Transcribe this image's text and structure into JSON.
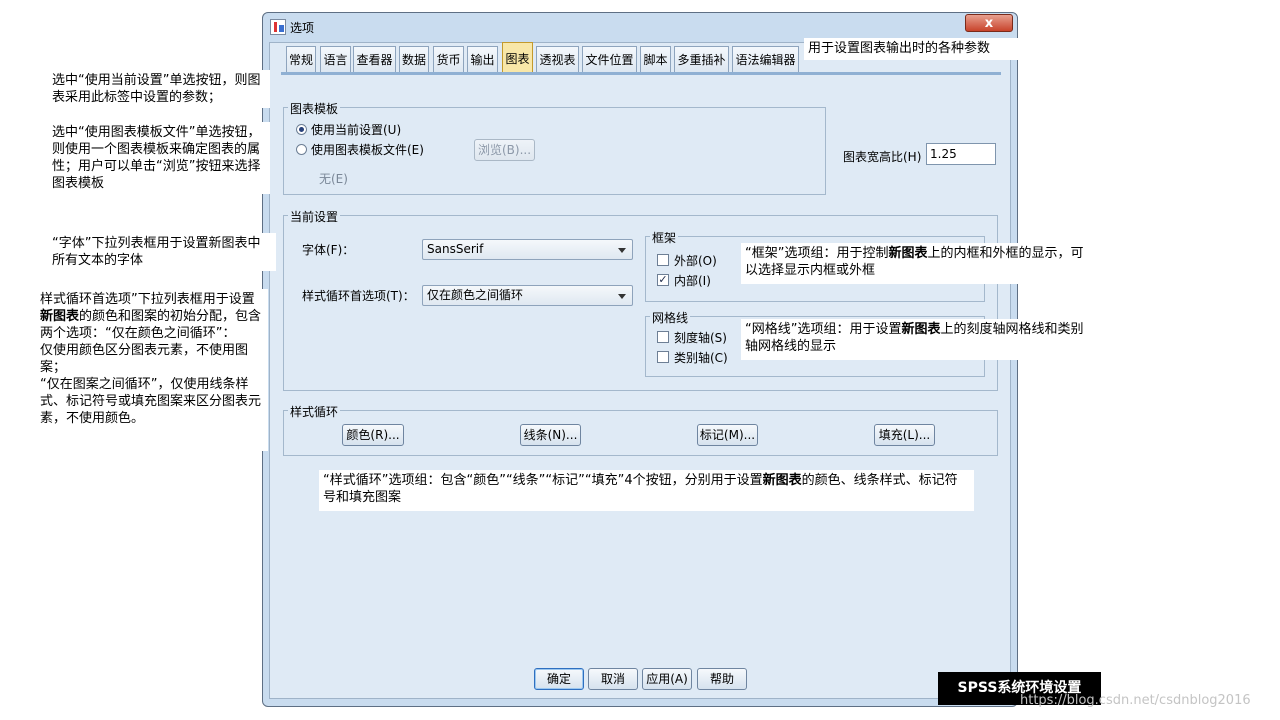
{
  "window": {
    "title": "选项",
    "close_glyph": "x"
  },
  "tabs": [
    {
      "label": "常规"
    },
    {
      "label": "语言"
    },
    {
      "label": "查看器"
    },
    {
      "label": "数据"
    },
    {
      "label": "货币"
    },
    {
      "label": "输出"
    },
    {
      "label": "图表",
      "active": true
    },
    {
      "label": "透视表"
    },
    {
      "label": "文件位置"
    },
    {
      "label": "脚本"
    },
    {
      "label": "多重插补"
    },
    {
      "label": "语法编辑器"
    }
  ],
  "template_group": {
    "title": "图表模板",
    "use_current": "使用当前设置(U)",
    "use_file": "使用图表模板文件(E)",
    "browse": "浏览(B)...",
    "none": "无(E)"
  },
  "aspect_ratio": {
    "label": "图表宽高比(H)",
    "value": "1.25"
  },
  "current_group": {
    "title": "当前设置",
    "font_label": "字体(F)：",
    "font_value": "SansSerif",
    "cycle_label": "样式循环首选项(T)：",
    "cycle_value": "仅在颜色之间循环"
  },
  "frame_group": {
    "title": "框架",
    "outer": "外部(O)",
    "inner": "内部(I)",
    "outer_checked": false,
    "inner_checked": true
  },
  "grid_group": {
    "title": "网格线",
    "scale": "刻度轴(S)",
    "category": "类别轴(C)",
    "scale_checked": false,
    "category_checked": false
  },
  "style_cycle_group": {
    "title": "样式循环",
    "color": "颜色(R)...",
    "line": "线条(N)...",
    "marker": "标记(M)...",
    "fill": "填充(L)..."
  },
  "footer": {
    "ok": "确定",
    "cancel": "取消",
    "apply": "应用(A)",
    "help": "帮助"
  },
  "annotations": {
    "top_right": "用于设置图表输出时的各种参数",
    "left1": "选中“使用当前设置”单选按钮，则图表采用此标签中设置的参数；",
    "left2": "选中“使用图表模板文件”单选按钮，则使用一个图表模板来确定图表的属性；用户可以单击“浏览”按钮来选择图表模板",
    "left3": "“字体”下拉列表框用于设置新图表中所有文本的字体",
    "left4_a": "样式循环首选项”下拉列表框用于设置",
    "left4_bold": "新图表",
    "left4_b": "的颜色和图案的初始分配，包含两个选项：“仅在颜色之间循环”：",
    "left4_c": "仅使用颜色区分图表元素，不使用图案；",
    "left4_d": "“仅在图案之间循环”，仅使用线条样式、标记符号或填充图案来区分图表元素，不使用颜色。",
    "frame_a": "“框架”选项组：用于控制",
    "frame_bold": "新图表",
    "frame_b": "上的内框和外框的显示，可以选择显示内框或外框",
    "grid_a": "“网格线”选项组：用于设置",
    "grid_bold": "新图表",
    "grid_b": "上的刻度轴网格线和类别轴网格线的显示",
    "cycle_a": "“样式循环”选项组：包含“颜色”“线条”“标记”“填充”4个按钮，分别用于设置",
    "cycle_bold": "新图表",
    "cycle_b": "的颜色、线条样式、标记符号和填充图案"
  },
  "badge": "SPSS系统环境设置",
  "watermark": "https://blog.csdn.net/csdnblog2016"
}
